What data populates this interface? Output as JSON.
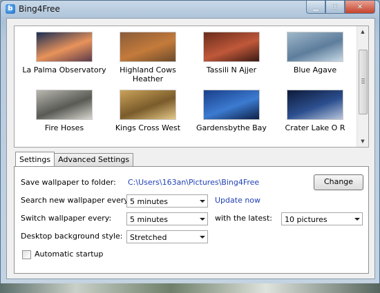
{
  "window": {
    "title": "Bing4Free",
    "app_icon_glyph": "b",
    "controls": {
      "minimize": "min-icon",
      "maximize": "max-icon",
      "close": "close-icon"
    }
  },
  "gallery": {
    "items": [
      {
        "label": "La Palma Observatory",
        "colors": [
          "#1b2e55",
          "#e8935a",
          "#5a3a4a"
        ]
      },
      {
        "label": "Highland Cows Heather",
        "colors": [
          "#8a5b3a",
          "#c47b3b",
          "#6b4a2a"
        ]
      },
      {
        "label": "Tassili N Ajjer",
        "colors": [
          "#6a2d1c",
          "#c0583a",
          "#3a1a14"
        ]
      },
      {
        "label": "Blue Agave",
        "colors": [
          "#9fb7c9",
          "#5d7d9c",
          "#c9dae6"
        ]
      },
      {
        "label": "Fire Hoses",
        "colors": [
          "#b8b8b0",
          "#5a5a55",
          "#d8d8d0"
        ]
      },
      {
        "label": "Kings Cross West",
        "colors": [
          "#caa25a",
          "#7a5b2a",
          "#e5c98a"
        ]
      },
      {
        "label": "Gardensbythe Bay",
        "colors": [
          "#1a3f8a",
          "#3c7bd1",
          "#0e1f45"
        ]
      },
      {
        "label": "Crater Lake O R",
        "colors": [
          "#0e1b3a",
          "#2c4f8f",
          "#b9c6dc"
        ]
      }
    ]
  },
  "tabs": [
    {
      "label": "Settings",
      "active": true
    },
    {
      "label": "Advanced Settings",
      "active": false
    }
  ],
  "settings": {
    "save_label": "Save wallpaper to folder:",
    "save_path": "C:\\Users\\163an\\Pictures\\Bing4Free",
    "change_button": "Change",
    "search_label": "Search new wallpaper every:",
    "search_value": "5 minutes",
    "update_link": "Update now",
    "switch_label": "Switch wallpaper every:",
    "switch_value": "5 minutes",
    "latest_label": "with the latest:",
    "latest_value": "10 pictures",
    "style_label": "Desktop background style:",
    "style_value": "Stretched",
    "autostart_label": "Automatic startup",
    "autostart_checked": false
  }
}
